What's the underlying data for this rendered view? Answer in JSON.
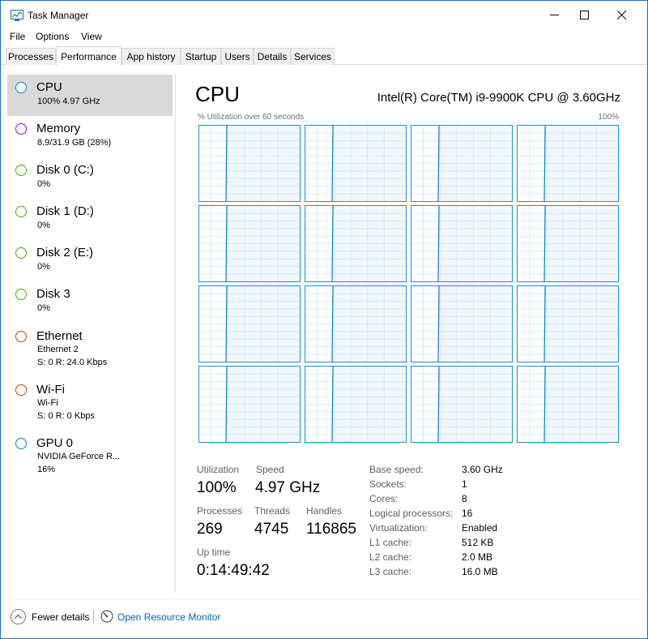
{
  "window": {
    "title": "Task Manager"
  },
  "menu": [
    "File",
    "Options",
    "View"
  ],
  "tabs": [
    {
      "label": "Processes"
    },
    {
      "label": "Performance"
    },
    {
      "label": "App history"
    },
    {
      "label": "Startup"
    },
    {
      "label": "Users"
    },
    {
      "label": "Details"
    },
    {
      "label": "Services"
    }
  ],
  "sidebar": {
    "items": [
      {
        "name": "CPU",
        "sub1": "100% 4.97 GHz",
        "sub2": "",
        "color": "#117dbb"
      },
      {
        "name": "Memory",
        "sub1": "8.9/31.9 GB (28%)",
        "sub2": "",
        "color": "#8b12ae"
      },
      {
        "name": "Disk 0 (C:)",
        "sub1": "0%",
        "sub2": "",
        "color": "#4da60c"
      },
      {
        "name": "Disk 1 (D:)",
        "sub1": "0%",
        "sub2": "",
        "color": "#4da60c"
      },
      {
        "name": "Disk 2 (E:)",
        "sub1": "0%",
        "sub2": "",
        "color": "#4da60c"
      },
      {
        "name": "Disk 3",
        "sub1": "0%",
        "sub2": "",
        "color": "#4da60c"
      },
      {
        "name": "Ethernet",
        "sub1": "Ethernet 2",
        "sub2": "S: 0 R: 24.0 Kbps",
        "color": "#a74f01"
      },
      {
        "name": "Wi-Fi",
        "sub1": "Wi-Fi",
        "sub2": "S: 0 R: 0 Kbps",
        "color": "#a74f01"
      },
      {
        "name": "GPU 0",
        "sub1": "NVIDIA GeForce R...",
        "sub2": "16%",
        "color": "#117dbb"
      }
    ]
  },
  "cpu": {
    "title": "CPU",
    "model": "Intel(R) Core(TM) i9-9900K CPU @ 3.60GHz",
    "graph_label": "% Utilization over 60 seconds",
    "graph_max": "100%",
    "graph_count": 16,
    "stats": {
      "utilization_label": "Utilization",
      "utilization": "100%",
      "speed_label": "Speed",
      "speed": "4.97 GHz",
      "processes_label": "Processes",
      "processes": "269",
      "threads_label": "Threads",
      "threads": "4745",
      "handles_label": "Handles",
      "handles": "116865",
      "uptime_label": "Up time",
      "uptime": "0:14:49:42"
    },
    "specs": [
      {
        "label": "Base speed:",
        "value": "3.60 GHz"
      },
      {
        "label": "Sockets:",
        "value": "1"
      },
      {
        "label": "Cores:",
        "value": "8"
      },
      {
        "label": "Logical processors:",
        "value": "16"
      },
      {
        "label": "Virtualization:",
        "value": "Enabled"
      },
      {
        "label": "L1 cache:",
        "value": "512 KB"
      },
      {
        "label": "L2 cache:",
        "value": "2.0 MB"
      },
      {
        "label": "L3 cache:",
        "value": "16.0 MB"
      }
    ]
  },
  "footer": {
    "fewer_details": "Fewer details",
    "resource_monitor": "Open Resource Monitor"
  },
  "colors": {
    "accent": "#117dbb",
    "graph_fill": "#f1f6fa",
    "link": "#0563c1"
  }
}
